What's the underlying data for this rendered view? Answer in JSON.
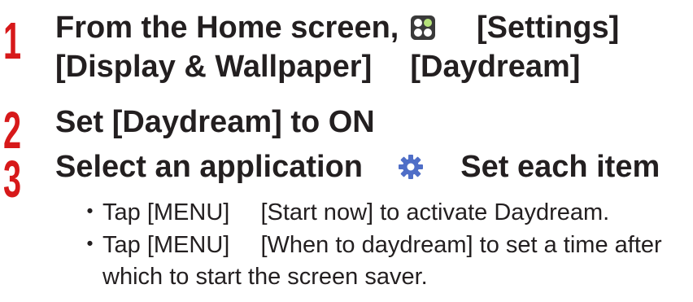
{
  "steps": [
    {
      "number": "1",
      "line1_a": "From the Home screen,",
      "line1_b": "[Settings]",
      "line2_a": "[Display & Wallpaper]",
      "line2_b": "[Daydream]"
    },
    {
      "number": "2",
      "text": "Set [Daydream] to ON"
    },
    {
      "number": "3",
      "text_a": "Select an application",
      "text_b": "Set each item"
    }
  ],
  "notes": [
    {
      "bullet": "・",
      "a": "Tap [MENU]",
      "b": "[Start now] to activate Daydream."
    },
    {
      "bullet": "・",
      "a": "Tap [MENU]",
      "b": "[When to daydream] to set a time after",
      "c": "which to start the screen saver."
    }
  ],
  "icons": {
    "apps": "apps-grid-icon",
    "settings": "gear-icon"
  },
  "colors": {
    "step_number": "#d7191a",
    "text": "#231f20",
    "gear_icon": "#4f6ec7"
  }
}
